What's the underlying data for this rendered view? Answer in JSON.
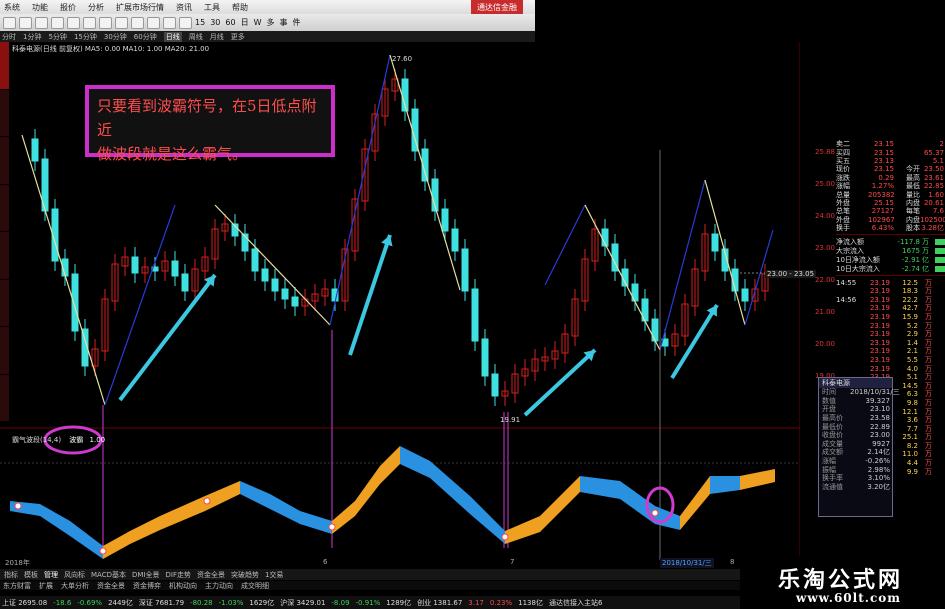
{
  "menubar": {
    "items": [
      "系统",
      "功能",
      "报价",
      "分析",
      "扩展市场行情",
      "资讯",
      "工具",
      "帮助"
    ],
    "corner": "通达信金融"
  },
  "toolbar": {
    "labels": [
      "15",
      "30",
      "60",
      "日",
      "W",
      "多",
      "事",
      "件"
    ]
  },
  "periods": [
    "分时",
    "1分钟",
    "5分钟",
    "15分钟",
    "30分钟",
    "60分钟",
    "日线",
    "周线",
    "月线",
    "更多"
  ],
  "active_period": "日线",
  "info_line": "科泰电源(日线 前复权)  MA5: 0.00  MA10: 1.00  MA20: 21.00",
  "callout": {
    "line1": "只要看到波霸符号，在5日低点附近",
    "line2": "做波段就是这么霸气。"
  },
  "chart_labels": {
    "top_value": "27.60",
    "low_value": "19.91",
    "current_price": "23.00 - 23.05"
  },
  "indicator": {
    "name": "霸气波段(14,4)",
    "tag": "波霸",
    "value": "1.00"
  },
  "date_axis": {
    "labels": [
      "2018年",
      "6",
      "7",
      "8"
    ],
    "marked": "2018/10/31/三"
  },
  "bottom_tabs": [
    "指标",
    "模板",
    "管理",
    "风向标",
    "MACD基本",
    "DMI全景",
    "DIF走势",
    "资金全景",
    "突破趋势",
    "1交易"
  ],
  "bottom_bar2": [
    "东方财富",
    "扩展",
    "大单分析",
    "资金全景",
    "资金博弈",
    "机构动向",
    "主力动向",
    "成交明细"
  ],
  "status": {
    "items": [
      {
        "text": "上证 2695.08",
        "cls": ""
      },
      {
        "text": "-18.6",
        "cls": "dn"
      },
      {
        "text": "-0.69%",
        "cls": "dn"
      },
      {
        "text": "2449亿",
        "cls": ""
      },
      {
        "text": "深证 7681.79",
        "cls": ""
      },
      {
        "text": "-80.28",
        "cls": "dn"
      },
      {
        "text": "-1.03%",
        "cls": "dn"
      },
      {
        "text": "1629亿",
        "cls": ""
      },
      {
        "text": "沪深 3429.01",
        "cls": ""
      },
      {
        "text": "-8.09",
        "cls": "dn"
      },
      {
        "text": "-0.91%",
        "cls": "dn"
      },
      {
        "text": "1289亿",
        "cls": ""
      },
      {
        "text": "创业 1381.67",
        "cls": ""
      },
      {
        "text": "3.17",
        "cls": "up"
      },
      {
        "text": "0.23%",
        "cls": "up"
      },
      {
        "text": "1138亿",
        "cls": ""
      },
      {
        "text": "通达信接入主站6",
        "cls": ""
      }
    ]
  },
  "price_axis": [
    "25.88",
    "25.00",
    "24.00",
    "23.00",
    "22.00",
    "21.00",
    "20.00",
    "19.00"
  ],
  "quote": {
    "rows": [
      [
        "卖二",
        "23.15",
        "",
        "2"
      ],
      [
        "买四",
        "23.15",
        "",
        "65.37"
      ],
      [
        "买五",
        "23.13",
        "",
        "5.1"
      ],
      [
        "现价",
        "23.15",
        "今开",
        "23.50"
      ],
      [
        "涨跌",
        "0.29",
        "最高",
        "23.61"
      ],
      [
        "涨幅",
        "1.27%",
        "最低",
        "22.85"
      ],
      [
        "总量",
        "205382",
        "量比",
        "1.60"
      ],
      [
        "外盘",
        "25.15",
        "内盘",
        "20.61"
      ],
      [
        "总笔",
        "27127",
        "每笔",
        "7.6"
      ],
      [
        "外盘",
        "102967",
        "内盘",
        "102500"
      ],
      [
        "换手",
        "6.43%",
        "股本",
        "3.28亿"
      ]
    ],
    "flows": [
      {
        "label": "净流入额",
        "value": "-117.8",
        "unit": "万"
      },
      {
        "label": "大宗流入",
        "value": "1675",
        "unit": "万"
      },
      {
        "label": "10日净流入额",
        "value": "-2.91",
        "unit": "亿"
      },
      {
        "label": "10日大宗流入",
        "value": "-2.74",
        "unit": "亿"
      }
    ],
    "ticks": [
      [
        "14:55",
        "23.19",
        "12.5",
        "万"
      ],
      [
        "",
        "23.19",
        "18.3",
        "万"
      ],
      [
        "14:56",
        "23.19",
        "22.2",
        "万"
      ],
      [
        "",
        "23.19",
        "42.7",
        "万"
      ],
      [
        "",
        "23.19",
        "15.9",
        "万"
      ],
      [
        "",
        "23.19",
        "5.2",
        "万"
      ],
      [
        "",
        "23.19",
        "2.9",
        "万"
      ],
      [
        "",
        "23.19",
        "1.4",
        "万"
      ],
      [
        "",
        "23.19",
        "2.1",
        "万"
      ],
      [
        "",
        "23.19",
        "5.5",
        "万"
      ],
      [
        "",
        "23.19",
        "4.0",
        "万"
      ],
      [
        "",
        "23.19",
        "5.1",
        "万"
      ],
      [
        "",
        "23.19",
        "14.5",
        "万"
      ],
      [
        "",
        "23.19",
        "6.3",
        "万"
      ],
      [
        "",
        "23.19",
        "9.8",
        "万"
      ],
      [
        "",
        "23.19",
        "12.1",
        "万"
      ],
      [
        "",
        "23.19",
        "3.6",
        "万"
      ],
      [
        "",
        "23.19",
        "7.7",
        "万"
      ],
      [
        "",
        "23.19",
        "25.1",
        "万"
      ],
      [
        "",
        "23.19",
        "8.2",
        "万"
      ],
      [
        "",
        "23.19",
        "11.0",
        "万"
      ],
      [
        "",
        "23.19",
        "4.4",
        "万"
      ],
      [
        "",
        "23.19",
        "9.9",
        "万"
      ]
    ]
  },
  "popup": {
    "title": "科泰电源",
    "rows": [
      [
        "时间",
        "2018/10/31/三"
      ],
      [
        "数值",
        "39.327"
      ],
      [
        "开盘",
        "23.10"
      ],
      [
        "最高价",
        "23.58"
      ],
      [
        "最低价",
        "22.89"
      ],
      [
        "收盘价",
        "23.00"
      ],
      [
        "成交量",
        "9927"
      ],
      [
        "成交额",
        "2.14亿"
      ],
      [
        "涨幅",
        "-0.26%"
      ],
      [
        "振幅",
        "2.98%"
      ],
      [
        "换手率",
        "3.10%"
      ],
      [
        "流通值",
        "3.20亿"
      ]
    ]
  },
  "brand": {
    "name": "乐淘公式网",
    "url": "www.60lt.com"
  },
  "colors": {
    "bull_candle": "#d62020",
    "bear_candle": "#3fe0e0",
    "down_trend_line": "#e8e0a0",
    "up_trend_line": "#2a3ad8",
    "arrow": "#3cc8e0",
    "callout_border": "#cc2ecc",
    "callout_text": "#ff4d4d",
    "vline": "#d03ad0",
    "band_up": "#f0a020",
    "band_down": "#2a90e0"
  }
}
